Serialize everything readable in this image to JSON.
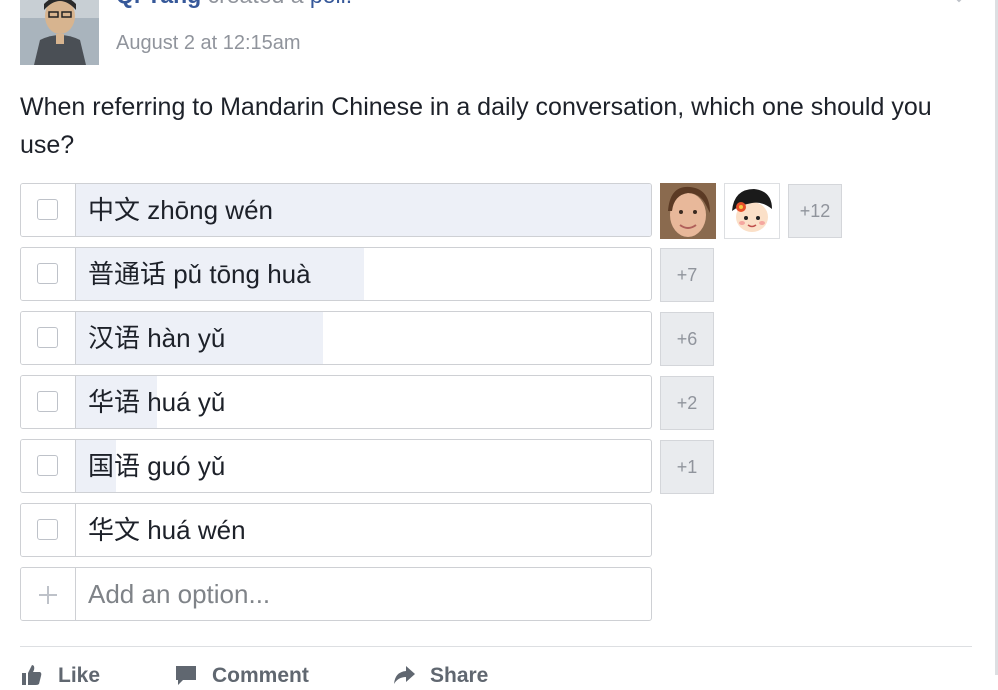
{
  "post": {
    "author": "Qi Yang",
    "action_text": "created a",
    "action_link": "poll.",
    "timestamp": "August 2 at 12:15am",
    "question": "When referring to Mandarin Chinese in a daily conversation, which one should you use?"
  },
  "poll": {
    "options": [
      {
        "label": "中文 zhōng wén",
        "vote_share": 1.0
      },
      {
        "label": "普通话 pǔ tōng huà",
        "vote_share": 0.5,
        "more_voters": "+7"
      },
      {
        "label": "汉语 hàn yǔ",
        "vote_share": 0.43,
        "more_voters": "+6"
      },
      {
        "label": "华语 huá yǔ",
        "vote_share": 0.14,
        "more_voters": "+2"
      },
      {
        "label": "国语 guó yǔ",
        "vote_share": 0.07,
        "more_voters": "+1"
      },
      {
        "label": "华文 huá wén",
        "vote_share": 0.0
      }
    ],
    "first_option_more_voters": "+12",
    "add_option_placeholder": "Add an option..."
  },
  "actions": {
    "like": "Like",
    "comment": "Comment",
    "share": "Share"
  },
  "colors": {
    "link": "#365899",
    "muted": "#90949c",
    "vote_fill": "#edf0f7",
    "border": "#ced0d4"
  }
}
